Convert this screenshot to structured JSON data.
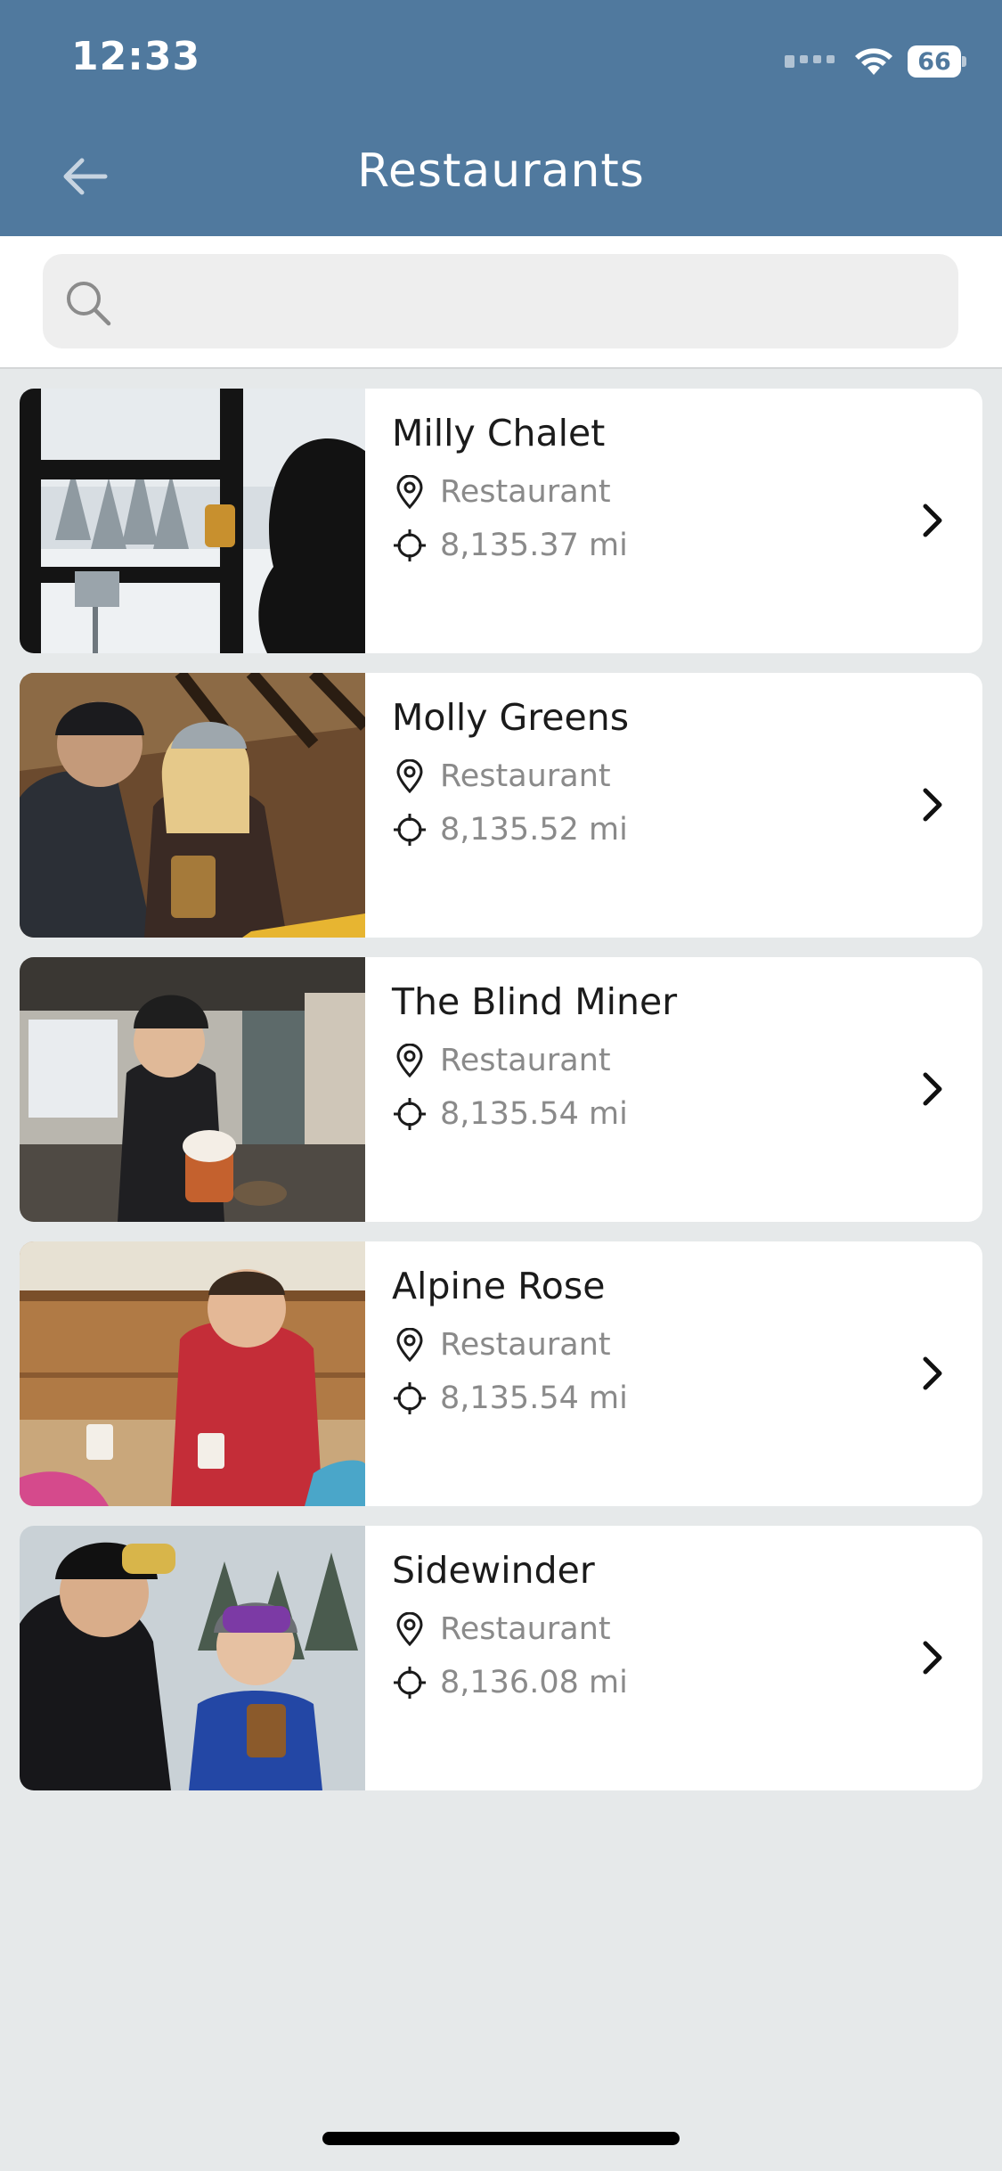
{
  "status_bar": {
    "time": "12:33",
    "battery": "66",
    "icons": [
      "signal-icon",
      "wifi-icon",
      "battery-icon"
    ]
  },
  "header": {
    "title": "Restaurants",
    "back_icon": "arrow-left-icon"
  },
  "search": {
    "value": "",
    "placeholder": "",
    "icon": "search-icon"
  },
  "restaurants": [
    {
      "name": "Milly Chalet",
      "type": "Restaurant",
      "distance": "8,135.37 mi",
      "photo": "person-drinking-beer-at-window-with-snowy-chairlift"
    },
    {
      "name": "Molly Greens",
      "type": "Restaurant",
      "distance": "8,135.52 mi",
      "photo": "couple-in-beanies-with-beer-and-nachos"
    },
    {
      "name": "The Blind Miner",
      "type": "Restaurant",
      "distance": "8,135.54 mi",
      "photo": "barista-serving-whipped-cream-drink"
    },
    {
      "name": "Alpine Rose",
      "type": "Restaurant",
      "distance": "8,135.54 mi",
      "photo": "man-in-red-jacket-laughing-at-table"
    },
    {
      "name": "Sidewinder",
      "type": "Restaurant",
      "distance": "8,136.08 mi",
      "photo": "two-women-in-ski-goggles-with-drinks"
    }
  ],
  "colors": {
    "header": "#50799e",
    "background": "#e6e9ea",
    "card": "#ffffff",
    "title_text": "#1b1b1b",
    "meta_text": "#8a8a8a"
  }
}
